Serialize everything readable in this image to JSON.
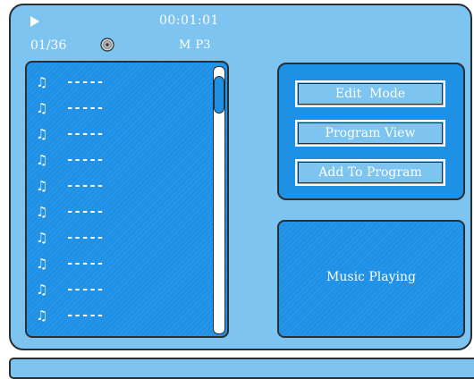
{
  "status": {
    "play_state_icon": "play-icon",
    "time": "00:01:01",
    "track_count": "01/36",
    "media_icon": "disc-icon",
    "format": "M P3"
  },
  "track_list": {
    "items": [
      {
        "icon": "music-note-icon",
        "title": "-----"
      },
      {
        "icon": "music-note-icon",
        "title": "-----"
      },
      {
        "icon": "music-note-icon",
        "title": "-----"
      },
      {
        "icon": "music-note-icon",
        "title": "-----"
      },
      {
        "icon": "music-note-icon",
        "title": "-----"
      },
      {
        "icon": "music-note-icon",
        "title": "-----"
      },
      {
        "icon": "music-note-icon",
        "title": "-----"
      },
      {
        "icon": "music-note-icon",
        "title": "-----"
      },
      {
        "icon": "music-note-icon",
        "title": "-----"
      },
      {
        "icon": "music-note-icon",
        "title": "-----"
      }
    ]
  },
  "menu": {
    "edit_mode_label": "Edit  Mode",
    "program_view_label": "Program View",
    "add_to_program_label": "Add To Program"
  },
  "status_panel": {
    "message": "Music Playing"
  },
  "colors": {
    "background": "#7dc4f0",
    "panel": "#1e90e6",
    "border": "#2a2f36",
    "text": "#ffffff"
  }
}
